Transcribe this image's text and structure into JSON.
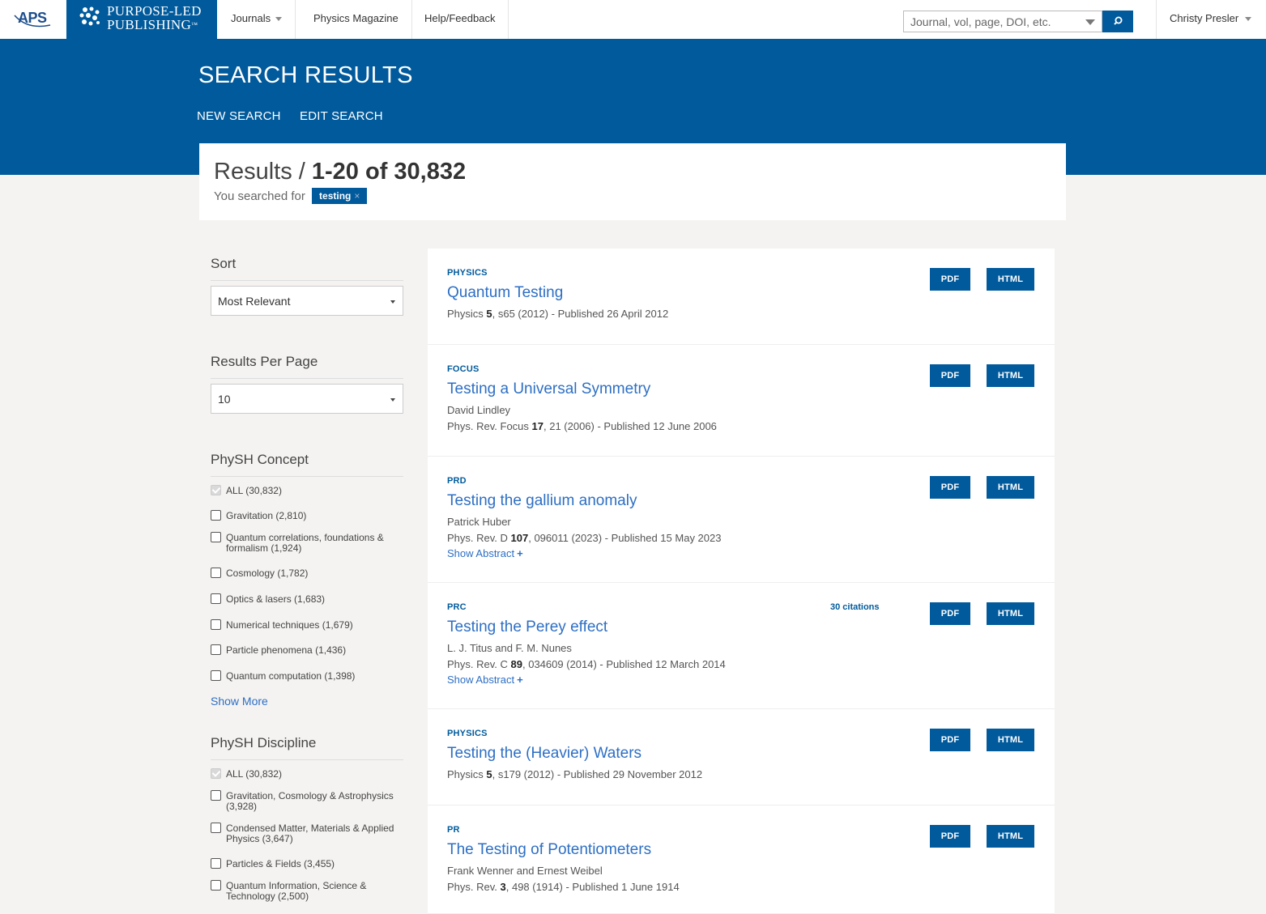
{
  "nav": {
    "aps_logo": "APS",
    "publisher_line1": "PURPOSE-LED",
    "publisher_line2": "PUBLISHING",
    "publisher_tm": "™",
    "journals": "Journals",
    "physics_magazine": "Physics Magazine",
    "help": "Help/Feedback",
    "search_placeholder": "Journal, vol, page, DOI, etc.",
    "user": "Christy Presler"
  },
  "banner": {
    "title": "SEARCH RESULTS",
    "new_search": "NEW SEARCH",
    "edit_search": "EDIT SEARCH"
  },
  "results": {
    "label": "Results /",
    "range": "1-20 of 30,832",
    "searched_for": "You searched for",
    "term": "testing",
    "term_remove": "×"
  },
  "sidebar": {
    "sort_heading": "Sort",
    "sort_value": "Most Relevant",
    "per_page_heading": "Results Per Page",
    "per_page_value": "10",
    "concept_heading": "PhySH Concept",
    "concepts": [
      {
        "label": "ALL (30,832)",
        "checked": true
      },
      {
        "label": "Gravitation (2,810)",
        "checked": false
      },
      {
        "label": "Quantum correlations, foundations & formalism (1,924)",
        "checked": false
      },
      {
        "label": "Cosmology (1,782)",
        "checked": false
      },
      {
        "label": "Optics & lasers (1,683)",
        "checked": false
      },
      {
        "label": "Numerical techniques (1,679)",
        "checked": false
      },
      {
        "label": "Particle phenomena (1,436)",
        "checked": false
      },
      {
        "label": "Quantum computation (1,398)",
        "checked": false
      }
    ],
    "show_more": "Show More",
    "discipline_heading": "PhySH Discipline",
    "disciplines": [
      {
        "label": "ALL (30,832)",
        "checked": true
      },
      {
        "label": "Gravitation, Cosmology & Astrophysics (3,928)",
        "checked": false
      },
      {
        "label": "Condensed Matter, Materials & Applied Physics (3,647)",
        "checked": false
      },
      {
        "label": "Particles & Fields (3,455)",
        "checked": false
      },
      {
        "label": "Quantum Information, Science & Technology (2,500)",
        "checked": false
      }
    ]
  },
  "buttons": {
    "pdf": "PDF",
    "html": "HTML"
  },
  "show_abstract": "Show Abstract",
  "show_abstract_plus": "+",
  "items": [
    {
      "journal": "PHYSICS",
      "title": "Quantum Testing",
      "authors": "",
      "cite_pre": "Physics ",
      "cite_vol": "5",
      "cite_post": ", s65 (2012) - Published 26 April 2012",
      "citations": ""
    },
    {
      "journal": "FOCUS",
      "title": "Testing a Universal Symmetry",
      "authors": "David Lindley",
      "cite_pre": "Phys. Rev. Focus ",
      "cite_vol": "17",
      "cite_post": ", 21 (2006) - Published 12 June 2006",
      "citations": ""
    },
    {
      "journal": "PRD",
      "title": "Testing the gallium anomaly",
      "authors": "Patrick Huber",
      "cite_pre": "Phys. Rev. D ",
      "cite_vol": "107",
      "cite_post": ", 096011 (2023) - Published 15 May 2023",
      "citations": ""
    },
    {
      "journal": "PRC",
      "title": "Testing the Perey effect",
      "authors": "L. J. Titus and F. M. Nunes",
      "cite_pre": "Phys. Rev. C ",
      "cite_vol": "89",
      "cite_post": ", 034609 (2014) - Published 12 March 2014",
      "citations": "30 citations"
    },
    {
      "journal": "PHYSICS",
      "title": "Testing the (Heavier) Waters",
      "authors": "",
      "cite_pre": "Physics ",
      "cite_vol": "5",
      "cite_post": ", s179 (2012) - Published 29 November 2012",
      "citations": ""
    },
    {
      "journal": "PR",
      "title": "The Testing of Potentiometers",
      "authors": "Frank Wenner and Ernest Weibel",
      "cite_pre": "Phys. Rev. ",
      "cite_vol": "3",
      "cite_post": ", 498 (1914) - Published 1 June 1914",
      "citations": ""
    }
  ],
  "colors": {
    "brand_blue": "#005a9c",
    "link_blue": "#2d6fc4",
    "page_bg": "#f4f3f1"
  }
}
